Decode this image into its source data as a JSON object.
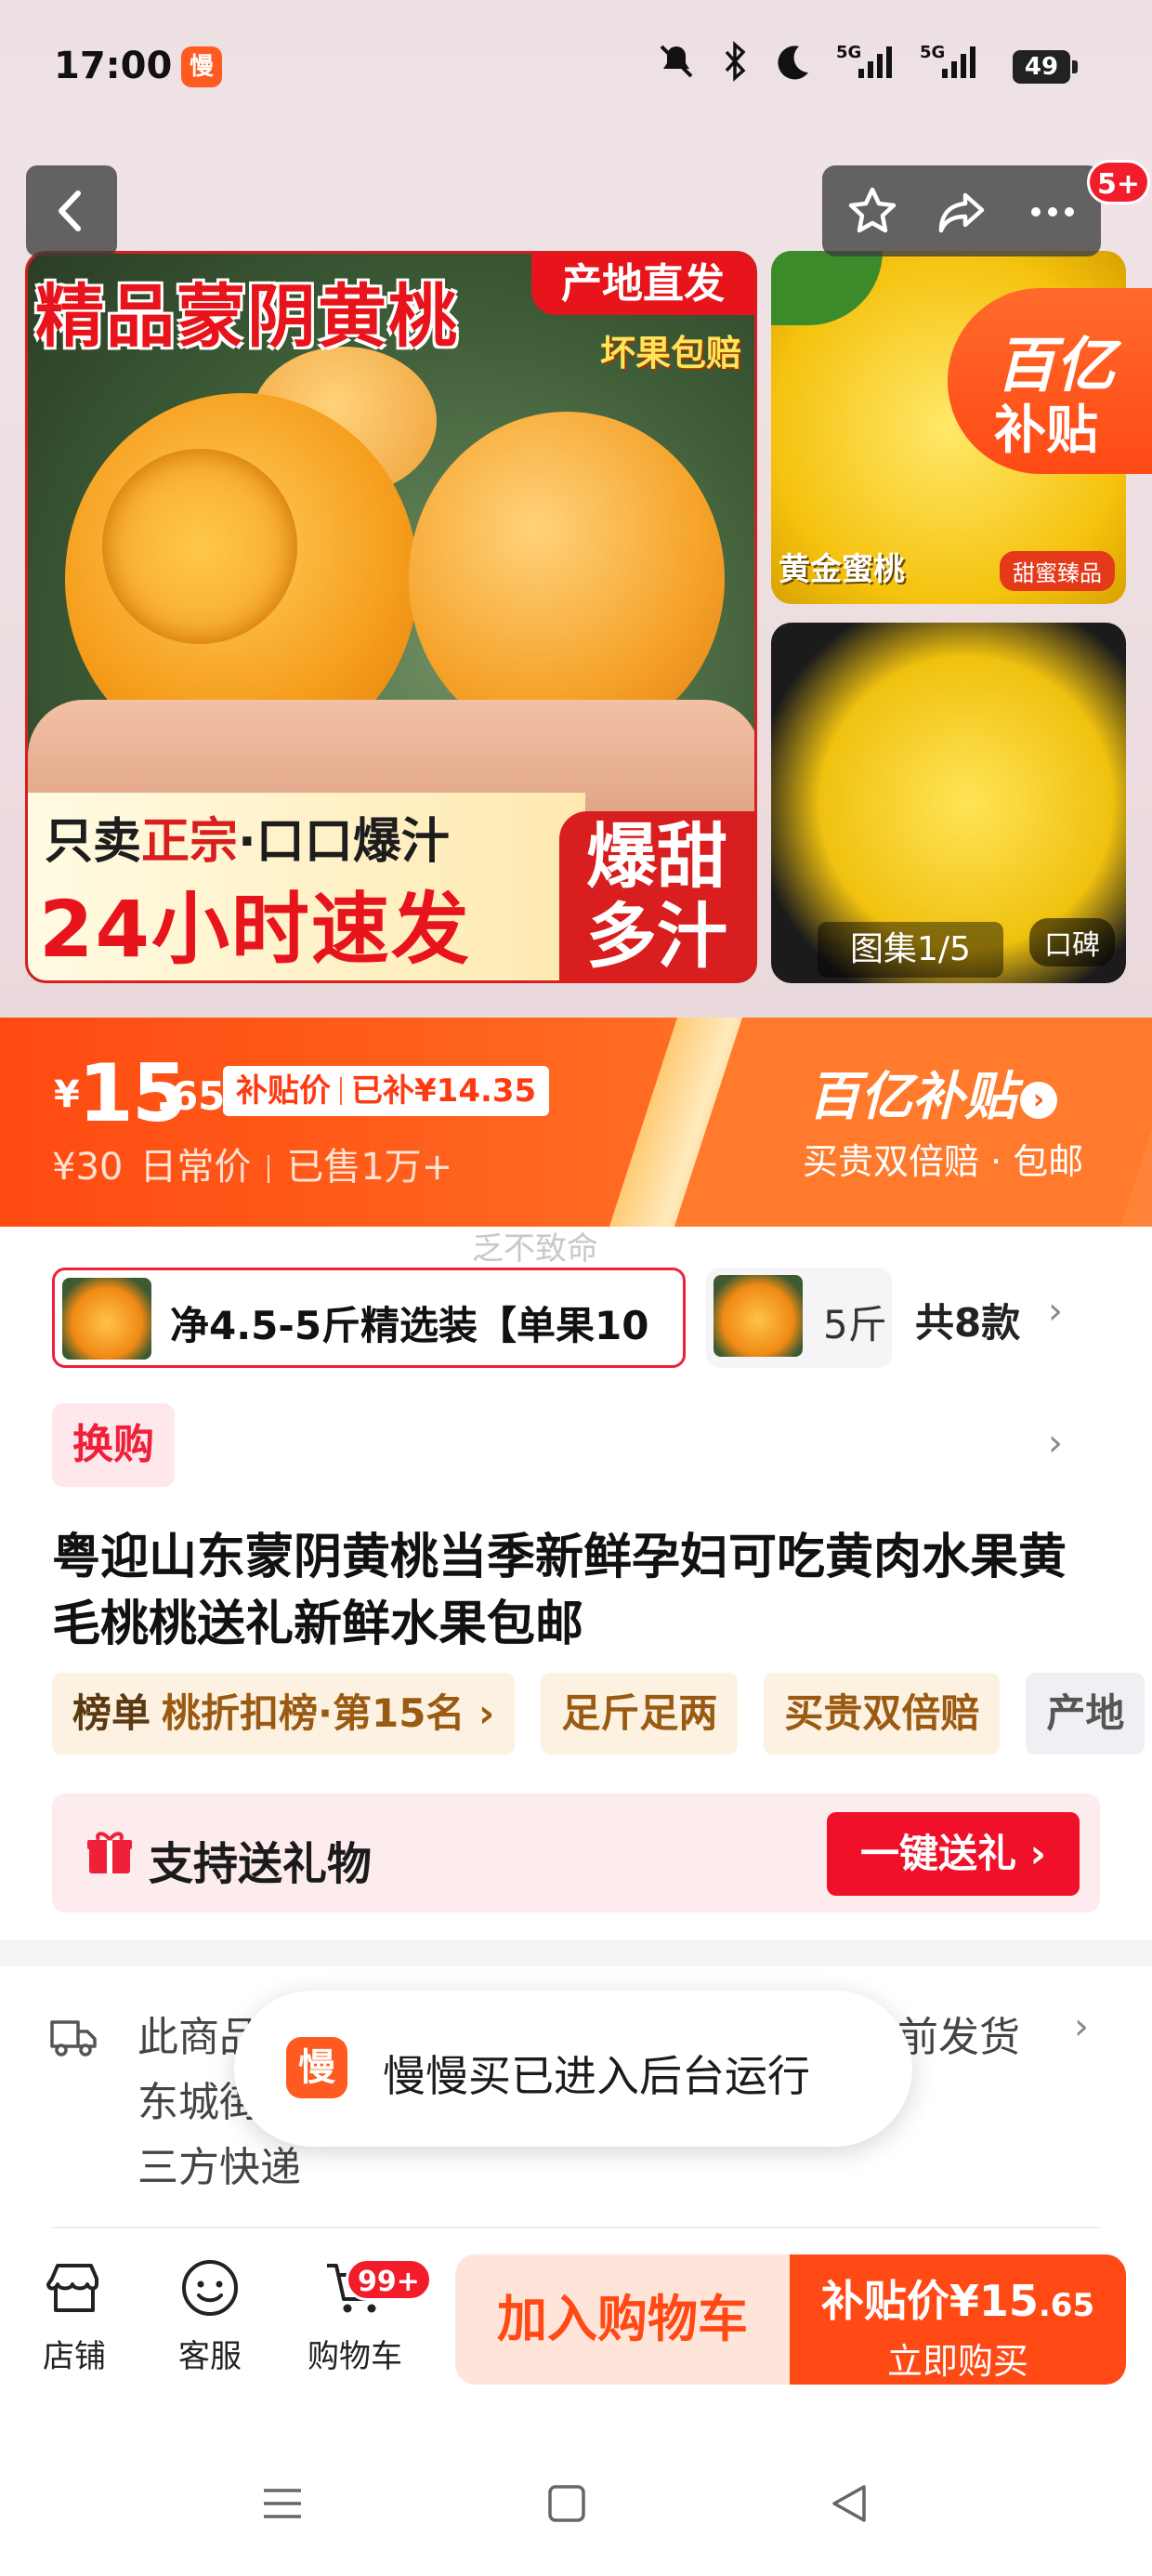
{
  "status_bar": {
    "time": "17:00",
    "app_icon_char": "慢",
    "network1": "5G",
    "network2": "5G",
    "battery": "49"
  },
  "gallery": {
    "main_title": "精品蒙阴黄桃",
    "tag_direct": "产地直发",
    "tag_guarantee": "坏果包赔",
    "band_line1_a": "只卖",
    "band_line1_b": "正宗",
    "band_line1_c": "·口口爆汁",
    "band_line2": "24小时速发",
    "burst": "爆甜多汁",
    "side1_label": "黄金蜜桃",
    "side1_tag": "甜蜜臻品",
    "side2_tag": "口碑",
    "yi_badge_line1": "百亿",
    "yi_badge_line2": "补贴",
    "counter": "图集1/5",
    "notification_badge": "5+"
  },
  "price": {
    "currency": "¥",
    "integer": "15",
    "decimal": ".65",
    "subsidy_label": "补贴价",
    "subsidy_amount": "已补¥14.35",
    "original": "¥30",
    "original_label": "日常价",
    "sold": "已售1万+",
    "program": "百亿补贴",
    "program_desc": "买贵双倍赔 · 包邮"
  },
  "watermark": "乏不致命",
  "sku": {
    "selected": "净4.5-5斤精选装【单果10",
    "other": "5斤",
    "count": "共8款"
  },
  "exchange_label": "换购",
  "product_title": "粤迎山东蒙阴黄桃当季新鲜孕妇可吃黄肉水果黄毛桃桃送礼新鲜水果包邮",
  "tags": {
    "rank_key": "榜单",
    "rank_value": "桃折扣榜·第15名 ›",
    "t2": "足斤足两",
    "t3": "买贵双倍赔",
    "t4": "产地"
  },
  "gift": {
    "label": "支持送礼物",
    "button": "一键送礼 ›"
  },
  "shipping": {
    "line1": "此商品",
    "line1_end": "前发货",
    "line2": "东城街",
    "line3": "三方快递"
  },
  "toast": {
    "icon_char": "慢",
    "text": "慢慢买已进入后台运行"
  },
  "bottom_bar": {
    "store": "店铺",
    "service": "客服",
    "cart": "购物车",
    "cart_badge": "99+",
    "add_to_cart": "加入购物车",
    "buy_price_label": "补贴价¥15",
    "buy_price_decimal": ".65",
    "buy_now": "立即购买"
  },
  "colors": {
    "accent": "#ff4a16",
    "brand_red": "#f0102a",
    "tag_bg": "#fdf1e1"
  }
}
